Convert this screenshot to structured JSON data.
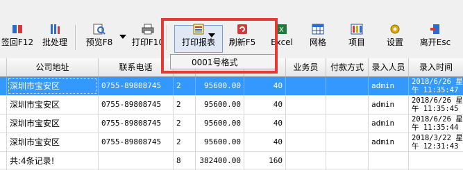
{
  "toolbar": {
    "items": [
      {
        "label": "签回F12",
        "icon": "sign-back-icon"
      },
      {
        "label": "批处理",
        "icon": "batch-process-icon"
      },
      {
        "label": "预览F8",
        "icon": "preview-icon"
      },
      {
        "label": "打印F10",
        "icon": "printer-icon"
      },
      {
        "label": "打印报表",
        "icon": "print-report-icon"
      },
      {
        "label": "刷新F5",
        "icon": "refresh-icon"
      },
      {
        "label": "Excel",
        "icon": "excel-icon"
      },
      {
        "label": "网格",
        "icon": "grid-icon"
      },
      {
        "label": "项目",
        "icon": "project-icon"
      },
      {
        "label": "设置",
        "icon": "settings-gear-icon"
      },
      {
        "label": "离开Esc",
        "icon": "exit-icon"
      }
    ],
    "dropdown_item": "0001号格式"
  },
  "colors": {
    "highlight": "#e53935",
    "selection": "#3399ff"
  },
  "table": {
    "headers": [
      "公司地址",
      "联系电话",
      "",
      "",
      "",
      "业务员",
      "付款方式",
      "录入人员",
      "录入时间"
    ],
    "rows": [
      {
        "addr": "深圳市宝安区",
        "phone": "0755-89808745",
        "c3": "2",
        "amount": "95600.00",
        "c5": "40",
        "sales": "",
        "pay": "",
        "user": "admin",
        "time1": "2018/6/26 星",
        "time2": "午 11:35:47"
      },
      {
        "addr": "深圳市宝安区",
        "phone": "0755-89808745",
        "c3": "2",
        "amount": "95600.00",
        "c5": "40",
        "sales": "",
        "pay": "",
        "user": "admin",
        "time1": "2018/6/26 星",
        "time2": "午 11:35:45"
      },
      {
        "addr": "深圳市宝安区",
        "phone": "0755-89808745",
        "c3": "2",
        "amount": "95600.00",
        "c5": "40",
        "sales": "",
        "pay": "",
        "user": "admin",
        "time1": "2018/6/26 星",
        "time2": "午 11:35:44"
      },
      {
        "addr": "深圳市宝安区",
        "phone": "0755-89808745",
        "c3": "2",
        "amount": "95600.00",
        "c5": "40",
        "sales": "",
        "pay": "",
        "user": "admin",
        "time1": "2018/3/22 星",
        "time2": "午 12:31:43"
      }
    ],
    "footer": {
      "addr": "共:4条记录!",
      "c3": "8",
      "amount": "382400.00",
      "c5": "160"
    }
  }
}
